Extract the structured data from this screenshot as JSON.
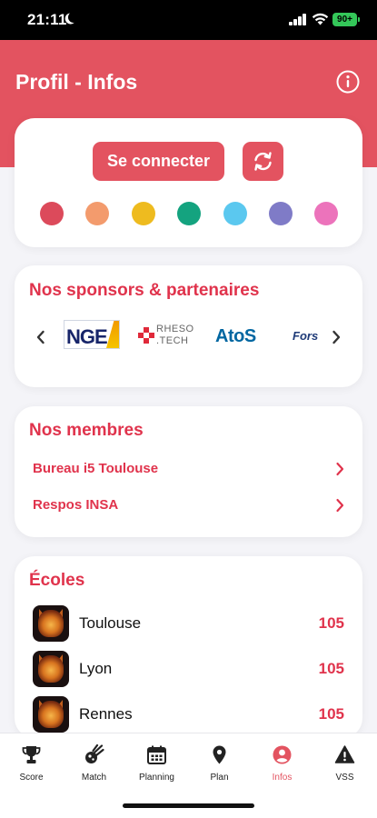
{
  "status_bar": {
    "time": "21:11",
    "battery": "90+"
  },
  "header": {
    "title": "Profil - Infos"
  },
  "account": {
    "connect_label": "Se connecter",
    "color_options": [
      "#dc4a5b",
      "#f39b6d",
      "#eebb1f",
      "#14a37f",
      "#5bc8ef",
      "#7f7bc7",
      "#ec73bb"
    ]
  },
  "sponsors": {
    "title": "Nos sponsors & partenaires",
    "logos": [
      "NGE",
      "RHESO .TECH",
      "AtoS",
      "Fors"
    ]
  },
  "members": {
    "title": "Nos membres",
    "items": [
      {
        "label": "Bureau i5 Toulouse"
      },
      {
        "label": "Respos INSA"
      }
    ]
  },
  "schools": {
    "title": "Écoles",
    "items": [
      {
        "name": "Toulouse",
        "score": "105"
      },
      {
        "name": "Lyon",
        "score": "105"
      },
      {
        "name": "Rennes",
        "score": "105"
      }
    ]
  },
  "tabs": [
    {
      "label": "Score",
      "icon": "trophy-icon",
      "active": false
    },
    {
      "label": "Match",
      "icon": "comet-icon",
      "active": false
    },
    {
      "label": "Planning",
      "icon": "calendar-icon",
      "active": false
    },
    {
      "label": "Plan",
      "icon": "map-pin-icon",
      "active": false
    },
    {
      "label": "Infos",
      "icon": "user-circle-icon",
      "active": true
    },
    {
      "label": "VSS",
      "icon": "warning-icon",
      "active": false
    }
  ],
  "colors": {
    "accent": "#e35360",
    "accent_text": "#e0334c",
    "background": "#f4f4f8"
  }
}
